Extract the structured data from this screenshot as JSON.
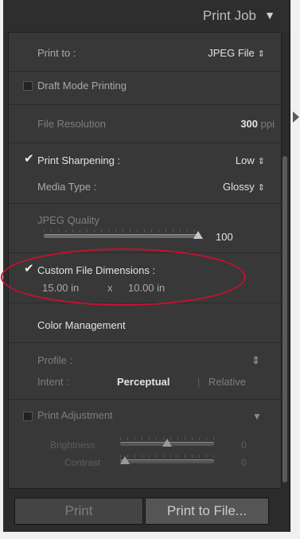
{
  "header": {
    "title": "Print Job",
    "collapse_glyph": "▼"
  },
  "print_to": {
    "label": "Print to :",
    "value": "JPEG File",
    "stepper": "⇕"
  },
  "draft_mode": {
    "label": "Draft Mode Printing",
    "checked": false
  },
  "file_resolution": {
    "label": "File Resolution",
    "value": "300",
    "unit": "ppi"
  },
  "print_sharpening": {
    "checkbox_glyph": "✔",
    "label": "Print Sharpening :",
    "value": "Low",
    "stepper": "⇕",
    "media_type_label": "Media Type :",
    "media_type_value": "Glossy"
  },
  "jpeg_quality": {
    "label": "JPEG Quality",
    "value": "100",
    "fraction": 1.0
  },
  "custom_dimensions": {
    "checkbox_glyph": "✔",
    "label": "Custom File Dimensions :",
    "width": "15.00 in",
    "separator": "x",
    "height": "10.00 in"
  },
  "color_management": {
    "title": "Color Management",
    "profile_label": "Profile :",
    "profile_stepper": "⇕",
    "intent_label": "Intent :",
    "intent_perceptual": "Perceptual",
    "intent_divider": "|",
    "intent_relative": "Relative"
  },
  "print_adjustment": {
    "label": "Print Adjustment",
    "dropdown_glyph": "▼",
    "brightness_label": "Brightness",
    "brightness_value": "0",
    "brightness_fraction": 0.5,
    "contrast_label": "Contrast",
    "contrast_value": "0",
    "contrast_fraction": 0.05
  },
  "buttons": {
    "print": "Print",
    "print_to_file": "Print to File..."
  },
  "icons": {
    "header": "triangle-down-icon",
    "panel_collapse": "triangle-right-icon",
    "checkbox": "checkmark-icon",
    "stepper": "up-down-arrows-icon"
  },
  "colors": {
    "annotation": "#c8102e",
    "panel": "#383838",
    "background": "#2b2b2b"
  }
}
